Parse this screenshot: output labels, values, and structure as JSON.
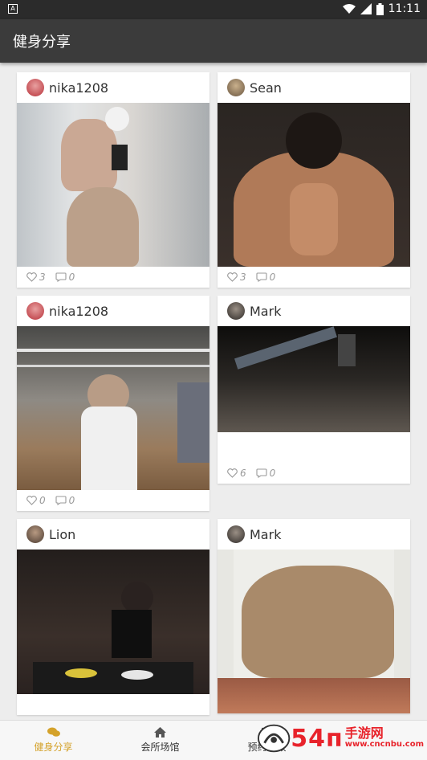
{
  "status_bar": {
    "time": "11:11",
    "notification_glyph": "A"
  },
  "app_bar": {
    "title": "健身分享"
  },
  "feed": [
    {
      "user": "nika1208",
      "likes": "3",
      "comments": "0"
    },
    {
      "user": "Sean",
      "likes": "3",
      "comments": "0"
    },
    {
      "user": "nika1208",
      "likes": "0",
      "comments": "0"
    },
    {
      "user": "Mark",
      "likes": "6",
      "comments": "0"
    },
    {
      "user": "Lion",
      "likes": "",
      "comments": ""
    },
    {
      "user": "Mark",
      "likes": "",
      "comments": ""
    }
  ],
  "tabs": [
    {
      "label": "健身分享",
      "icon": "chat-bubbles-icon",
      "active": true
    },
    {
      "label": "会所场馆",
      "icon": "home-icon",
      "active": false
    },
    {
      "label": "预约私教",
      "icon": "calendar-icon",
      "active": false
    },
    {
      "label": "",
      "icon": "",
      "active": false
    }
  ],
  "watermark": {
    "main": "54п",
    "line1": "手游网",
    "line2": "www.cncnbu.com"
  },
  "colors": {
    "accent": "#d4a22a",
    "appbar": "#3b3b3b",
    "statusbar": "#2b2b2b"
  }
}
